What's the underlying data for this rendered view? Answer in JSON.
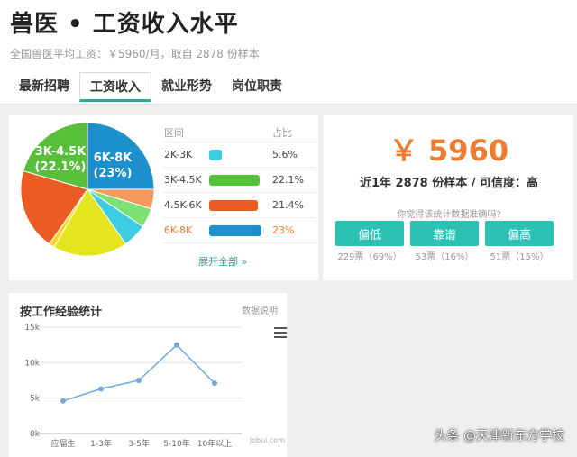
{
  "header": {
    "title": "兽医 • 工资收入水平",
    "subtitle": "全国兽医平均工资：￥5960/月，取自 2878 份样本"
  },
  "tabs": [
    {
      "label": "最新招聘"
    },
    {
      "label": "工资收入",
      "active": true
    },
    {
      "label": "就业形势"
    },
    {
      "label": "岗位职责"
    }
  ],
  "distribution": {
    "col_range": "区间",
    "col_pct": "占比",
    "rows": [
      {
        "range": "2K-3K",
        "pct": "5.6%",
        "value": 5.6,
        "color": "#3ccde3"
      },
      {
        "range": "3K-4.5K",
        "pct": "22.1%",
        "value": 22.1,
        "color": "#58bf3b"
      },
      {
        "range": "4.5K-6K",
        "pct": "21.4%",
        "value": 21.4,
        "color": "#ec5b23"
      },
      {
        "range": "6K-8K",
        "pct": "23%",
        "value": 23,
        "color": "#1d8fcc",
        "highlight": true
      }
    ],
    "expand_label": "展开全部 »",
    "pie_labels": {
      "a_range": "6K-8K",
      "a_pct": "(23%)",
      "b_range": "3K-4.5K",
      "b_pct": "(22.1%)"
    },
    "pie_other_colors": [
      "#ffd52a",
      "#e5e51f",
      "#f6995c",
      "#7de075"
    ]
  },
  "summary": {
    "amount": "￥ 5960",
    "sample_text": "近1年 2878 份样本 / 可信度：高",
    "question": "你觉得该统计数据准确吗?",
    "votes": [
      {
        "label": "偏低",
        "count": "229票（69%）"
      },
      {
        "label": "靠谱",
        "count": "53票（16%）"
      },
      {
        "label": "偏高",
        "count": "51票（15%）"
      }
    ],
    "accent": "#ee7d31",
    "button_color": "#2dc0b4"
  },
  "experience": {
    "title": "按工作经验统计",
    "link": "数据说明",
    "menu_icon": "hamburger-menu-icon",
    "site_mark": "jobui.com"
  },
  "chart_data": {
    "type": "line",
    "categories": [
      "应届生",
      "1-3年",
      "3-5年",
      "5-10年",
      "10年以上"
    ],
    "values": [
      4600,
      6300,
      7500,
      12500,
      7100
    ],
    "y_ticks": [
      "0k",
      "5k",
      "10k",
      "15k"
    ],
    "ylim": [
      0,
      15000
    ],
    "grid": true,
    "color": "#6fa8dc"
  },
  "watermark": "头条 @天津新东方学校"
}
